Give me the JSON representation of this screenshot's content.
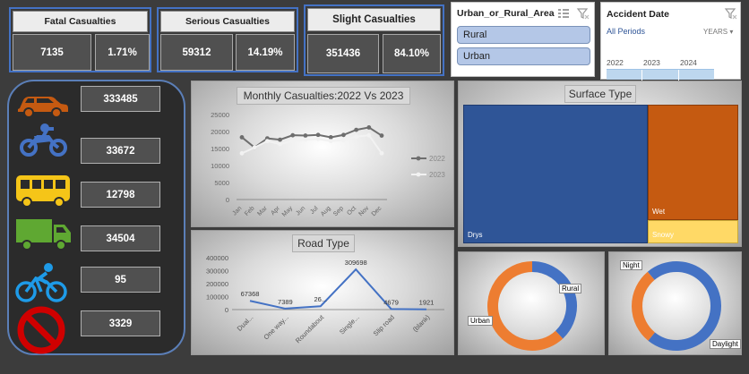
{
  "kpis": {
    "fatal": {
      "label": "Fatal Casualties",
      "count": "7135",
      "pct": "1.71%"
    },
    "serious": {
      "label": "Serious Casualties",
      "count": "59312",
      "pct": "14.19%"
    },
    "slight": {
      "label": "Slight Casualties",
      "count": "351436",
      "pct": "84.10%"
    }
  },
  "area_slicer": {
    "title": "Urban_or_Rural_Area",
    "items": [
      "Rural",
      "Urban"
    ]
  },
  "date_slicer": {
    "title": "Accident Date",
    "periods": "All Periods",
    "unit": "YEARS",
    "years": [
      "2022",
      "2023",
      "2024"
    ]
  },
  "vehicles": [
    {
      "icon": "car-icon",
      "value": "333485"
    },
    {
      "icon": "motorcycle-icon",
      "value": "33672"
    },
    {
      "icon": "bus-icon",
      "value": "12798"
    },
    {
      "icon": "truck-icon",
      "value": "34504"
    },
    {
      "icon": "bicycle-icon",
      "value": "95"
    },
    {
      "icon": "prohibited-icon",
      "value": "3329"
    }
  ],
  "colors": {
    "blue": "#4472c4",
    "orange": "#c55a11",
    "navy": "#2f5597",
    "yellow": "#ffd966",
    "bus_yellow": "#f5c518",
    "truck_green": "#5fa832",
    "cycle_blue": "#1e9be8",
    "stop_red": "#d00000"
  },
  "chart_data": [
    {
      "type": "line",
      "title": "Monthly Casualties:2022 Vs 2023",
      "categories": [
        "Jan",
        "Feb",
        "Mar",
        "Apr",
        "May",
        "Jun",
        "Jul",
        "Aug",
        "Sep",
        "Oct",
        "Nov",
        "Dec"
      ],
      "series": [
        {
          "name": "2022",
          "values": [
            18300,
            15300,
            18000,
            17600,
            18900,
            18800,
            19000,
            18300,
            19000,
            20500,
            21200,
            18800
          ]
        },
        {
          "name": "2023",
          "values": [
            13600,
            15300,
            17200,
            16300,
            17200,
            17600,
            17800,
            17200,
            17500,
            18500,
            18900,
            13600
          ]
        }
      ],
      "y_ticks": [
        "0",
        "5000",
        "10000",
        "15000",
        "20000",
        "25000"
      ],
      "ylim": [
        0,
        25000
      ],
      "legend": "right"
    },
    {
      "type": "line",
      "title": "Road Type",
      "categories": [
        "Dual...",
        "One way...",
        "Roundabout",
        "Single...",
        "Slip road",
        "(blank)"
      ],
      "values": [
        67368,
        7389,
        26000,
        309698,
        4679,
        1921
      ],
      "value_labels": [
        "67368",
        "7389",
        "26...",
        "309698",
        "4679",
        "1921"
      ],
      "y_ticks": [
        "0",
        "100000",
        "200000",
        "300000",
        "400000"
      ],
      "ylim": [
        0,
        400000
      ]
    },
    {
      "type": "treemap",
      "title": "Surface Type",
      "items": [
        {
          "label": "Drys",
          "share": 0.66
        },
        {
          "label": "Wet",
          "share": 0.28
        },
        {
          "label": "Snowy",
          "share": 0.06
        }
      ]
    },
    {
      "type": "pie",
      "donut": true,
      "labels": [
        "Rural",
        "Urban"
      ],
      "values": [
        38,
        62
      ]
    },
    {
      "type": "pie",
      "donut": true,
      "labels": [
        "Daylight",
        "Night"
      ],
      "values": [
        72,
        28
      ]
    }
  ]
}
